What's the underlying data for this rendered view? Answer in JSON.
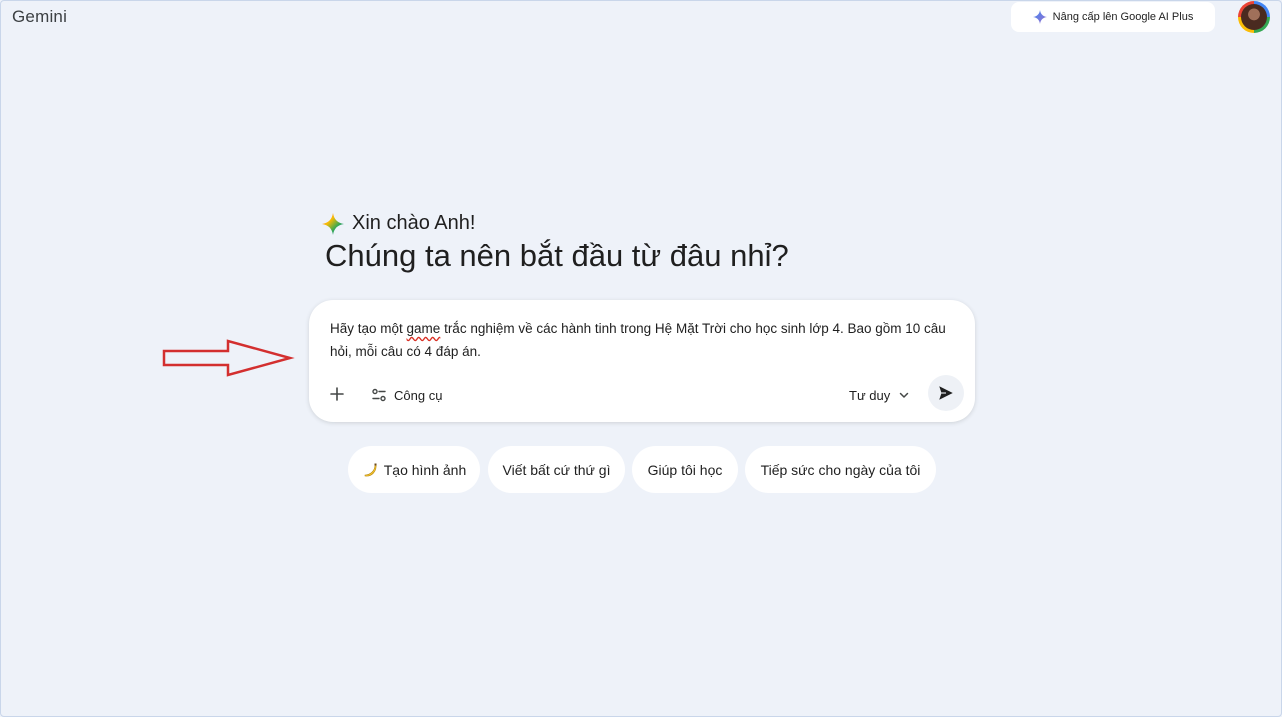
{
  "app": {
    "title": "Gemini"
  },
  "header": {
    "upgrade_label": "Nâng cấp lên Google AI Plus",
    "avatar_icon": "user-avatar"
  },
  "greeting": {
    "hello": "Xin chào Anh!",
    "headline": "Chúng ta nên bắt đầu từ đâu nhỉ?"
  },
  "prompt": {
    "text_part1": "Hãy tạo một ",
    "text_misspelled": "game",
    "text_part2": " trắc nghiệm về các hành tinh trong Hệ Mặt Trời cho học sinh lớp 4. Bao gồm 10 câu hỏi, mỗi câu có 4 đáp án.",
    "add_icon": "plus-icon",
    "tools_label": "Công cụ",
    "mode_label": "Tư duy",
    "send_icon": "send-icon"
  },
  "suggestions": [
    {
      "label": "Tạo hình ảnh",
      "icon": "banana-emoji"
    },
    {
      "label": "Viết bất cứ thứ gì"
    },
    {
      "label": "Giúp tôi học"
    },
    {
      "label": "Tiếp sức cho ngày của tôi"
    }
  ],
  "colors": {
    "background": "#eef2f9",
    "card": "#ffffff",
    "annotation_arrow": "#d32f2f"
  }
}
